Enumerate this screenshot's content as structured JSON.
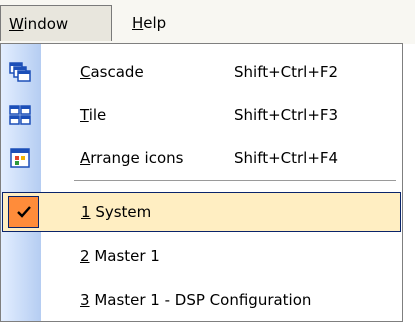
{
  "menubar": {
    "window": {
      "mnemonic": "W",
      "rest": "indow"
    },
    "help": {
      "mnemonic": "H",
      "rest": "elp"
    }
  },
  "menu": {
    "items": [
      {
        "mnemonic": "C",
        "rest": "ascade",
        "shortcut": "Shift+Ctrl+F2",
        "icon": "cascade-icon"
      },
      {
        "mnemonic": "T",
        "rest": "ile",
        "shortcut": "Shift+Ctrl+F3",
        "icon": "tile-icon"
      },
      {
        "mnemonic": "A",
        "rest": "rrange icons",
        "shortcut": "Shift+Ctrl+F4",
        "icon": "arrange-icons-icon"
      }
    ],
    "windows": [
      {
        "mnemonic": "1",
        "rest": " System",
        "checked": true
      },
      {
        "mnemonic": "2",
        "rest": " Master 1",
        "checked": false
      },
      {
        "mnemonic": "3",
        "rest": " Master 1 - DSP Configuration",
        "checked": false
      }
    ]
  },
  "colors": {
    "highlight_bg": "#ffeec2",
    "highlight_border": "#0a246a",
    "check_bg": "#ff8c3a",
    "gutter_start": "#e3eeff",
    "gutter_end": "#b5cdf2"
  }
}
